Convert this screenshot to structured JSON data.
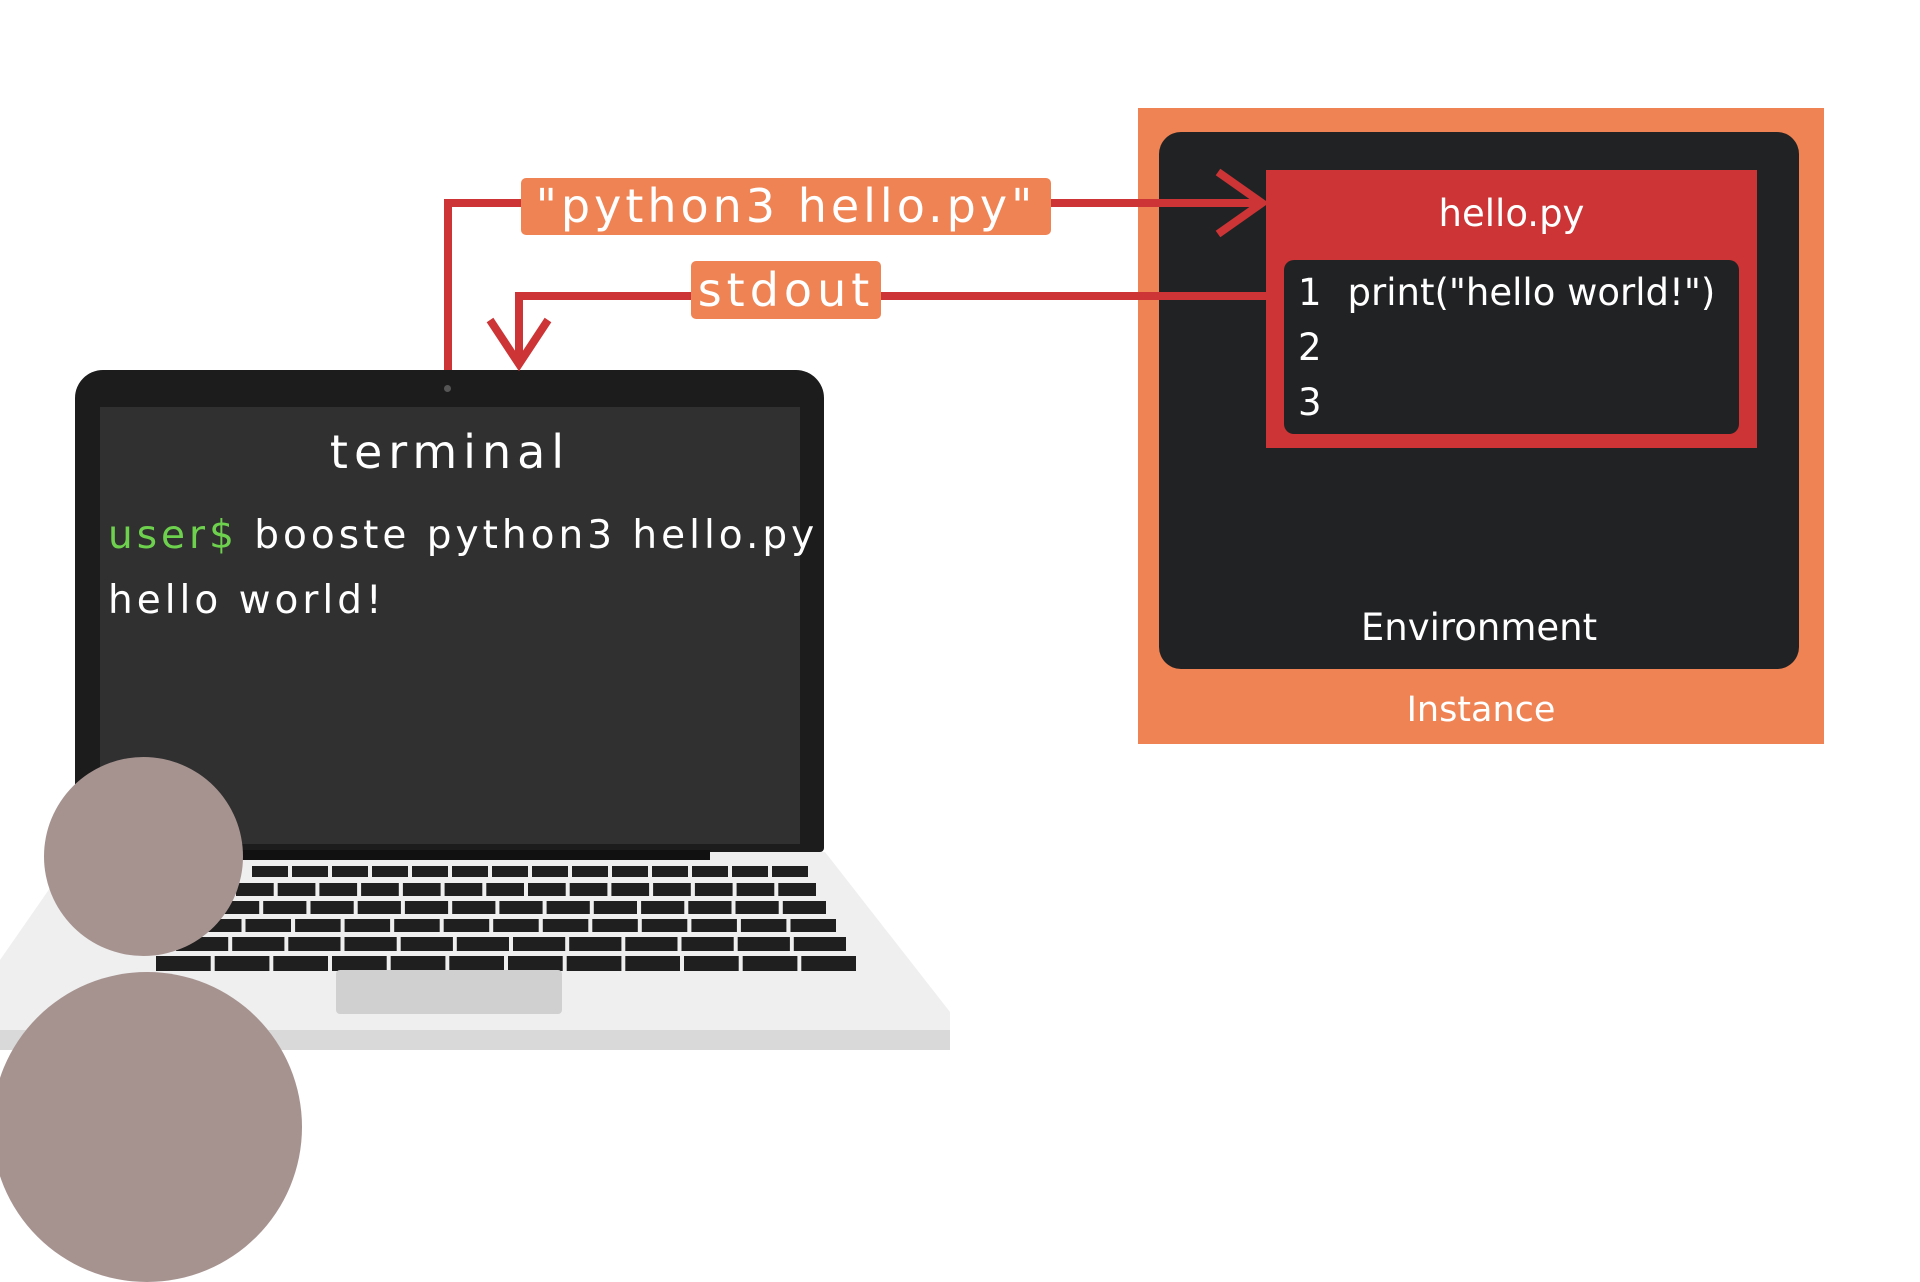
{
  "command_label": "\"python3 hello.py\"",
  "stdout_label": "stdout",
  "terminal": {
    "title": "terminal",
    "prompt": "user$",
    "command": "booste python3 hello.py",
    "output": "hello world!"
  },
  "file": {
    "name": "hello.py",
    "lines": [
      {
        "number": "1",
        "code": "print(\"hello world!\")"
      },
      {
        "number": "2",
        "code": ""
      },
      {
        "number": "3",
        "code": ""
      }
    ]
  },
  "environment_label": "Environment",
  "instance_label": "Instance",
  "colors": {
    "orange": "#ef8354",
    "red": "#cc3435",
    "dark": "#212224",
    "prompt_green": "#6ed14e",
    "person": "#a69390"
  }
}
